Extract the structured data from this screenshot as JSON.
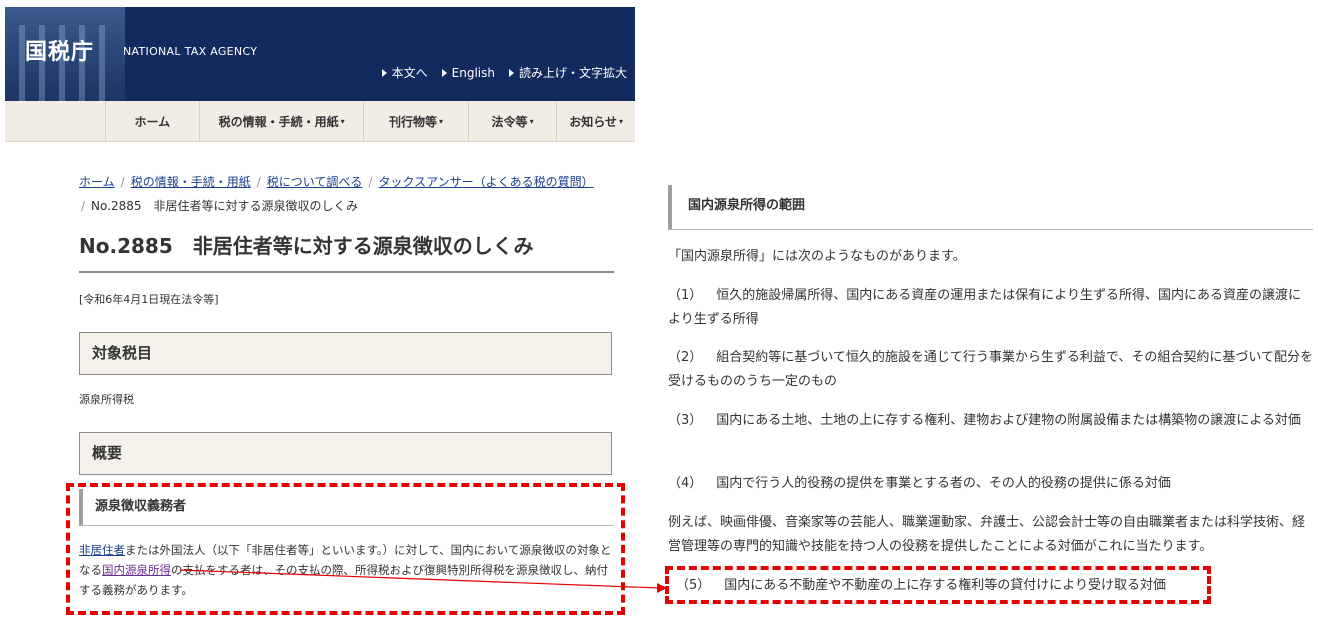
{
  "header": {
    "logo": "国税庁",
    "agency_en": "NATIONAL TAX AGENCY",
    "utility_links": [
      "本文へ",
      "English",
      "読み上げ・文字拡大"
    ]
  },
  "global_nav": [
    {
      "label": "ホーム"
    },
    {
      "label": "税の情報・手続・用紙"
    },
    {
      "label": "刊行物等"
    },
    {
      "label": "法令等"
    },
    {
      "label": "お知らせ"
    }
  ],
  "breadcrumb": {
    "items": [
      "ホーム",
      "税の情報・手続・用紙",
      "税について調べる",
      "タックスアンサー（よくある税の質問）"
    ],
    "current": "No.2885　非居住者等に対する源泉徴収のしくみ"
  },
  "page": {
    "title": "No.2885　非居住者等に対する源泉徴収のしくみ",
    "as_of": "[令和6年4月1日現在法令等]",
    "section_target": "対象税目",
    "target_value": "源泉所得税",
    "section_overview": "概要",
    "subsection_withholding": "源泉徴収義務者",
    "para": {
      "link1": "非居住者",
      "text1": "または外国法人（以下「非居住者等」といいます。）に対して、国内において源泉徴収の対象となる",
      "link2": "国内源泉所得",
      "text2": "の支払をする者は、その支払の際、所得税および復興特別所得税を源泉徴収し、納付する義務があります。"
    }
  },
  "right": {
    "heading": "国内源泉所得の範囲",
    "intro": "「国内源泉所得」には次のようなものがあります。",
    "items": [
      {
        "num": "（1）",
        "text": "恒久的施設帰属所得、国内にある資産の運用または保有により生ずる所得、国内にある資産の譲渡により生ずる所得"
      },
      {
        "num": "（2）",
        "text": "組合契約等に基づいて恒久的施設を通じて行う事業から生ずる利益で、その組合契約に基づいて配分を受けるもののうち一定のもの"
      },
      {
        "num": "（3）",
        "text": "国内にある土地、土地の上に存する権利、建物および建物の附属設備または構築物の譲渡による対価"
      },
      {
        "num": "（4）",
        "text": "国内で行う人的役務の提供を事業とする者の、その人的役務の提供に係る対価"
      }
    ],
    "example": "例えば、映画俳優、音楽家等の芸能人、職業運動家、弁護士、公認会計士等の自由職業者または科学技術、経営管理等の専門的知識や技能を持つ人の役務を提供したことによる対価がこれに当たります。",
    "item5": {
      "num": "（5）",
      "text": "国内にある不動産や不動産の上に存する権利等の貸付けにより受け取る対価"
    }
  },
  "colors": {
    "header_bg": "#132a5e",
    "nav_bg": "#f2ede4",
    "highlight": "#e60000",
    "link": "#1a3f8f"
  }
}
